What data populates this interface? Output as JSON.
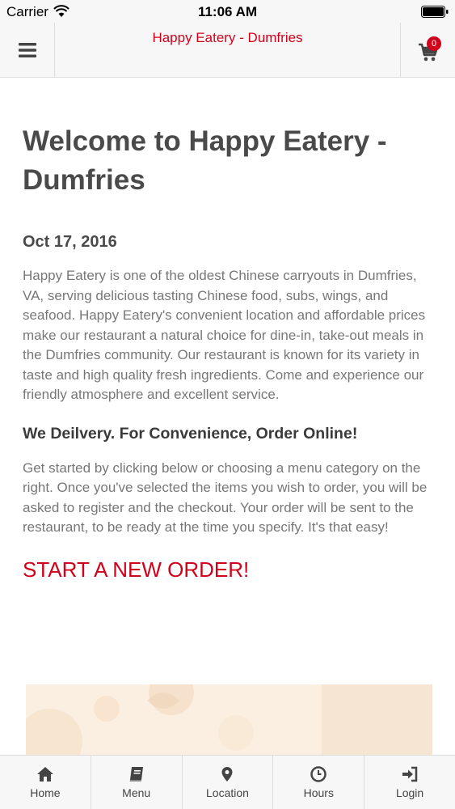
{
  "status_bar": {
    "carrier": "Carrier",
    "time": "11:06 AM"
  },
  "header": {
    "title": "Happy Eatery - Dumfries",
    "cart_count": "0"
  },
  "main": {
    "welcome_title": "Welcome to Happy Eatery - Dumfries",
    "date": "Oct 17, 2016",
    "about": "Happy Eatery is one of the oldest Chinese carryouts in Dumfries, VA, serving delicious tasting Chinese food, subs, wings, and seafood. Happy Eatery's convenient location and affordable prices make our restaurant a natural choice for dine-in, take-out meals in the Dumfries community. Our restaurant is known for its variety in taste and high quality fresh ingredients. Come and experience our friendly atmosphere and excellent service.",
    "delivery_heading": "We Deilvery. For Convenience, Order Online!",
    "instructions": "Get started by clicking below or choosing a menu category on the right. Once you've selected the items you wish to order, you will be asked to register and the checkout. Your order will be sent to the restaurant, to be ready at the time you specify. It's that easy!",
    "cta": "START A NEW ORDER!"
  },
  "tabs": [
    {
      "label": "Home",
      "icon": "home-icon"
    },
    {
      "label": "Menu",
      "icon": "book-icon"
    },
    {
      "label": "Location",
      "icon": "map-marker-icon"
    },
    {
      "label": "Hours",
      "icon": "clock-icon"
    },
    {
      "label": "Login",
      "icon": "sign-in-icon"
    }
  ],
  "colors": {
    "accent": "#d0021b",
    "text": "#4a4a4a",
    "muted": "#777777",
    "bar": "#f7f7f7"
  }
}
